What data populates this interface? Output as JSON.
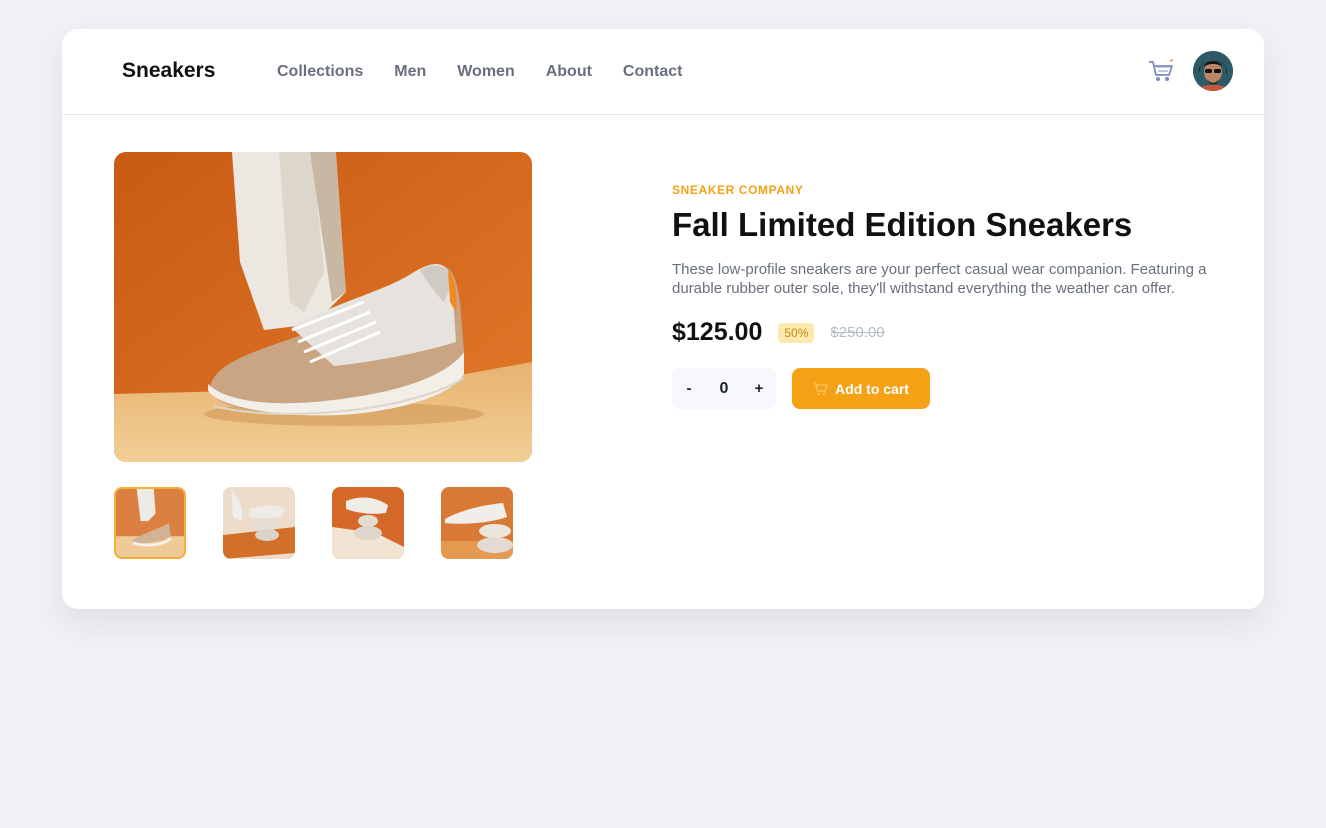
{
  "nav": {
    "logo": "Sneakers",
    "links": [
      "Collections",
      "Men",
      "Women",
      "About",
      "Contact"
    ]
  },
  "icons": {
    "cart": "cart-icon",
    "avatar": "user-avatar"
  },
  "gallery": {
    "thumbnails": [
      "thumbnail-1",
      "thumbnail-2",
      "thumbnail-3",
      "thumbnail-4"
    ],
    "selected_index": 0
  },
  "product": {
    "company": "SNEAKER COMPANY",
    "title": "Fall Limited Edition Sneakers",
    "description": "These low-profile sneakers are your perfect casual wear companion. Featuring a durable rubber outer sole, they'll withstand everything the weather can offer.",
    "price": "$125.00",
    "discount": "50%",
    "original_price": "$250.00"
  },
  "cart": {
    "minus_label": "-",
    "quantity": "0",
    "plus_label": "+",
    "add_label": "Add to cart"
  },
  "colors": {
    "accent": "#f4a116",
    "discount_bg": "#fde9ad",
    "background": "#f1f1f5"
  }
}
